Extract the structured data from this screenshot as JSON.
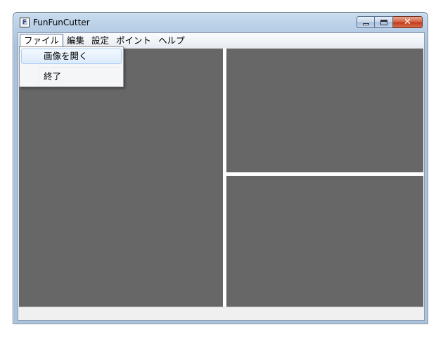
{
  "window": {
    "title": "FunFunCutter",
    "app_icon_letter": "F",
    "icons": {
      "minimize": "minimize-icon",
      "maximize": "maximize-icon",
      "close": "close-icon"
    }
  },
  "menubar": {
    "items": [
      {
        "label": "ファイル"
      },
      {
        "label": "編集"
      },
      {
        "label": "設定"
      },
      {
        "label": "ポイント"
      },
      {
        "label": "ヘルプ"
      }
    ]
  },
  "file_menu": {
    "items": [
      {
        "label": "画像を開く"
      },
      {
        "label": "終了"
      }
    ]
  },
  "colors": {
    "pane": "#676767",
    "title_bar": "#b8cfe6",
    "close_button": "#c1381a"
  }
}
